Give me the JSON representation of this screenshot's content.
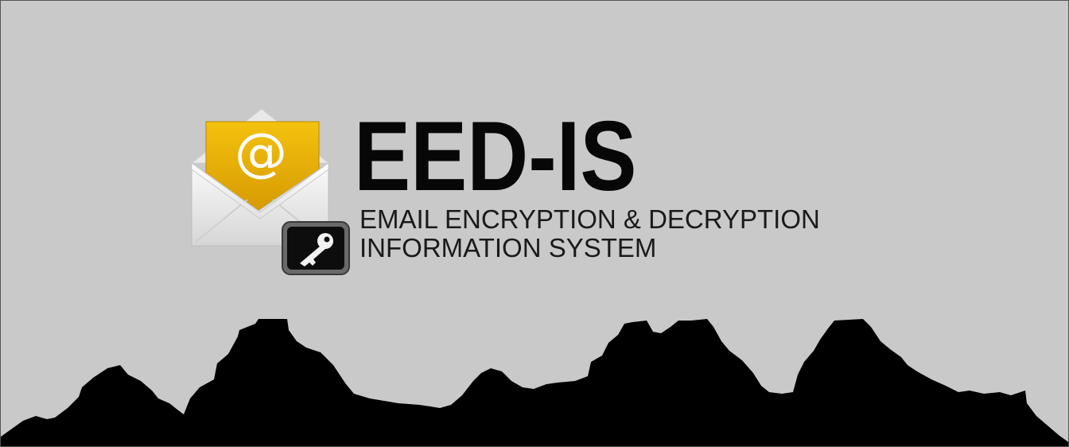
{
  "brand": {
    "title": "EED-IS",
    "subtitle_line1": "EMAIL ENCRYPTION & DECRYPTION",
    "subtitle_line2": "INFORMATION SYSTEM",
    "logo_glyph": "@",
    "icons": [
      "envelope-icon",
      "at-sign-icon",
      "key-icon"
    ]
  },
  "colors": {
    "background": "#c9c9c9",
    "accent_gold": "#e4a906",
    "silhouette": "#000000",
    "text": "#0a0a0a"
  }
}
